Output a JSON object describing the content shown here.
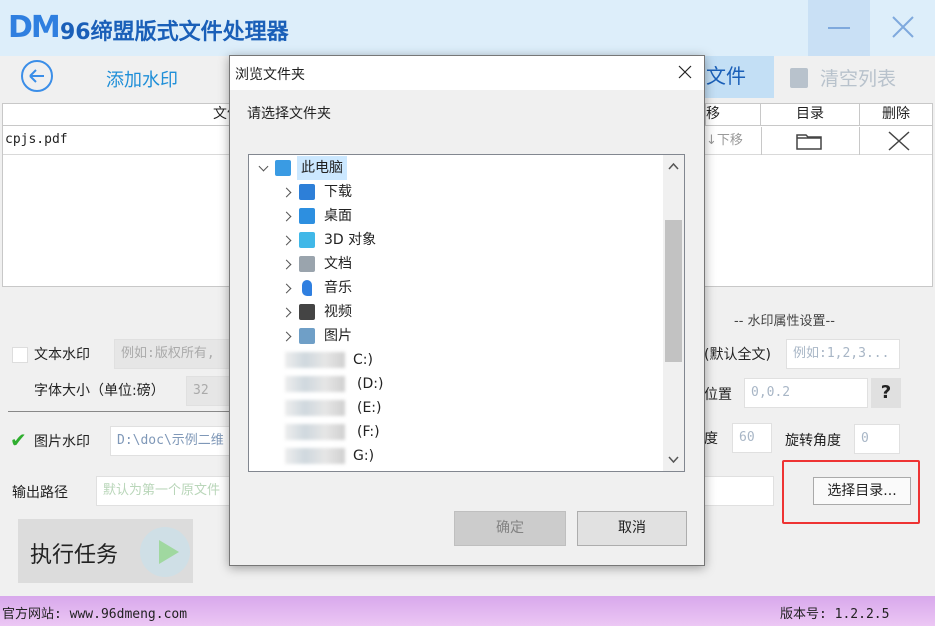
{
  "app": {
    "logo": "DM",
    "title": "96缔盟版式文件处理器"
  },
  "toolbar": {
    "add_watermark": "添加水印",
    "add_file_partial": "文件",
    "clear_list": "清空列表"
  },
  "table": {
    "headers": [
      "文件",
      "移",
      "目录",
      "删除"
    ],
    "rows": [
      {
        "name": "cpjs.pdf",
        "move_down": "↓下移"
      }
    ]
  },
  "form": {
    "text_watermark_label": "文本水印",
    "text_watermark_placeholder": "例如:版权所有,",
    "font_size_label": "字体大小（单位:磅）",
    "font_size_value": "32",
    "image_watermark_label": "图片水印",
    "image_watermark_path": "D:\\doc\\示例二维",
    "output_path_label": "输出路径",
    "output_path_placeholder": "默认为第一个原文件",
    "attr_header": "-- 水印属性设置--",
    "pages_label": "(默认全文)",
    "pages_placeholder": "例如:1,2,3...",
    "position_label": "位置",
    "position_value": "0,0.2",
    "help": "?",
    "opacity_label_partial": "度",
    "opacity_value": "60",
    "rotation_label": "旋转角度",
    "rotation_value": "0",
    "select_dir_button": "选择目录...",
    "execute_button": "执行任务"
  },
  "footer": {
    "site": "官方网站:  www.96dmeng.com",
    "version": "版本号: 1.2.2.5"
  },
  "dialog": {
    "title": "浏览文件夹",
    "prompt": "请选择文件夹",
    "tree": [
      {
        "label": "此电脑",
        "icon": "computer-icon",
        "level": 0,
        "expanded": true
      },
      {
        "label": "下载",
        "icon": "download-folder-icon",
        "level": 1
      },
      {
        "label": "桌面",
        "icon": "desktop-folder-icon",
        "level": 1
      },
      {
        "label": "3D 对象",
        "icon": "3d-objects-icon",
        "level": 1
      },
      {
        "label": "文档",
        "icon": "documents-icon",
        "level": 1
      },
      {
        "label": "音乐",
        "icon": "music-icon",
        "level": 1
      },
      {
        "label": "视频",
        "icon": "video-icon",
        "level": 1
      },
      {
        "label": "图片",
        "icon": "pictures-icon",
        "level": 1
      },
      {
        "label": "C:)",
        "icon": "drive-icon",
        "level": 1
      },
      {
        "label": "(D:)",
        "icon": "drive-icon",
        "level": 1
      },
      {
        "label": "(E:)",
        "icon": "drive-icon",
        "level": 1
      },
      {
        "label": "(F:)",
        "icon": "drive-icon",
        "level": 1
      },
      {
        "label": "G:)",
        "icon": "drive-icon",
        "level": 1
      }
    ],
    "ok": "确定",
    "cancel": "取消"
  },
  "colors": {
    "titlebar": "#ddeefa",
    "accent": "#1f8fd8",
    "highlight_frame": "#e33333",
    "footer": "#e4b8f0"
  }
}
